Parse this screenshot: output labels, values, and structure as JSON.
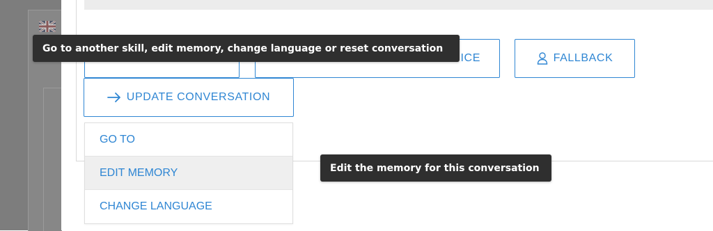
{
  "language_icon": "uk-flag-icon",
  "buttons": {
    "hidden_left_label": "",
    "hidden_middle_label_visible_part": "ICE",
    "fallback": {
      "label": "FALLBACK",
      "icon": "person-icon"
    },
    "update_conversation": {
      "label": "UPDATE CONVERSATION",
      "icon": "arrow-right-icon"
    }
  },
  "dropdown": {
    "items": [
      {
        "label": "GO TO"
      },
      {
        "label": "EDIT MEMORY",
        "hovered": true
      },
      {
        "label": "CHANGE LANGUAGE"
      }
    ]
  },
  "tooltips": {
    "update_conversation": "Go to another skill, edit memory, change language or reset conversation",
    "edit_memory": "Edit the memory for this conversation"
  },
  "colors": {
    "accent": "#2f86d3",
    "tooltip_bg": "#2f2f2f",
    "overlay": "#7d7d7d"
  }
}
